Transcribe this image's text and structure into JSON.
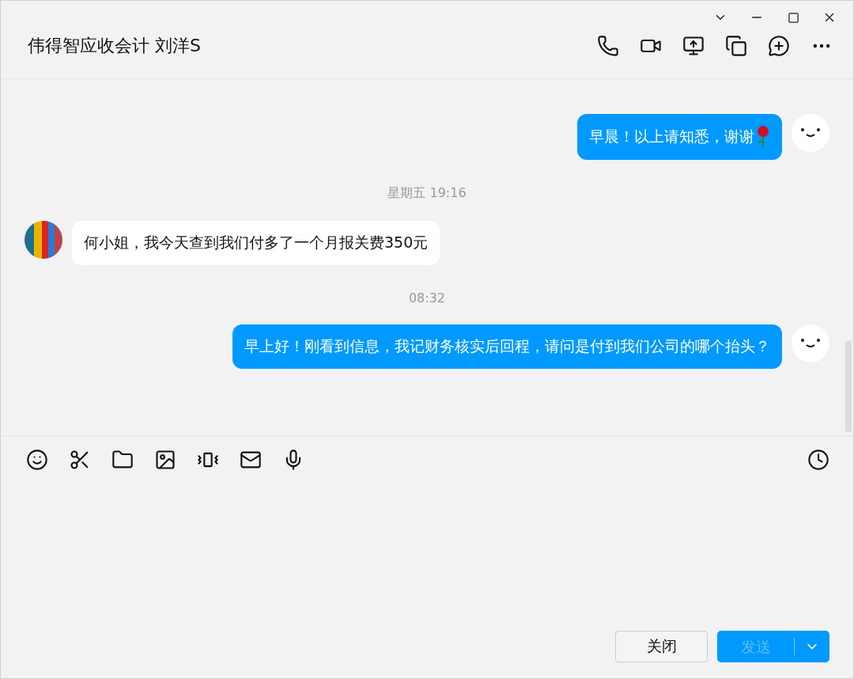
{
  "window": {
    "title": "伟得智应收会计 刘洋S"
  },
  "messages": [
    {
      "kind": "outgoing",
      "text": "早晨！以上请知悉，谢谢",
      "rose": true
    },
    {
      "kind": "time",
      "text": "星期五 19:16"
    },
    {
      "kind": "incoming",
      "text": "何小姐，我今天查到我们付多了一个月报关费350元"
    },
    {
      "kind": "time",
      "text": "08:32"
    },
    {
      "kind": "outgoing",
      "text": "早上好！刚看到信息，我记财务核实后回程，请问是付到我们公司的哪个抬头？",
      "rose": false
    }
  ],
  "buttons": {
    "close": "关闭",
    "send": {
      "label": "发送",
      "disabled": true
    }
  }
}
